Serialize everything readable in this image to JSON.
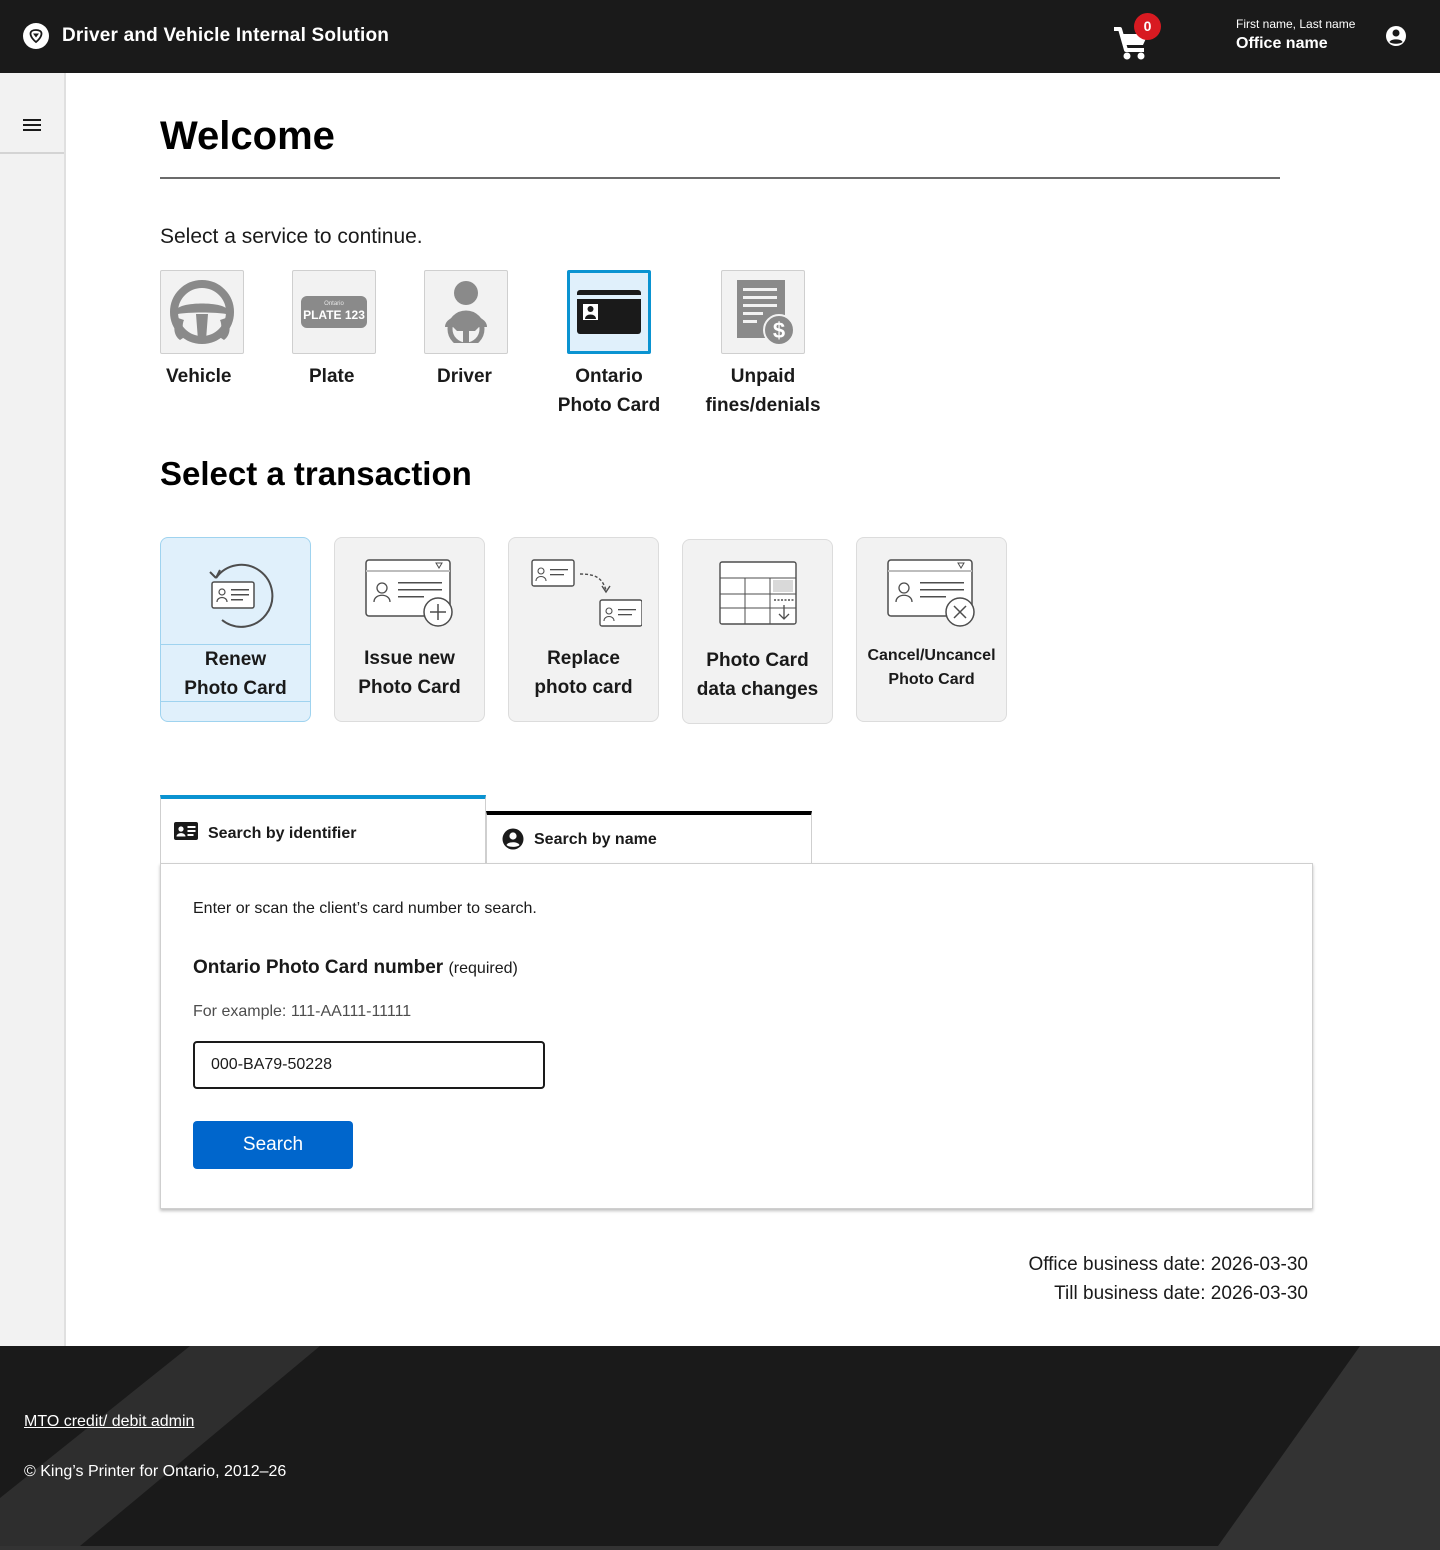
{
  "header": {
    "app_title": "Driver and Vehicle Internal Solution",
    "cart_count": "0",
    "user_name": "First name, Last name",
    "office_name": "Office name"
  },
  "main": {
    "title": "Welcome",
    "service_prompt": "Select a service to continue.",
    "services": [
      {
        "label_1": "Vehicle",
        "label_2": "",
        "icon": "steering-wheel-icon"
      },
      {
        "label_1": "Plate",
        "label_2": "",
        "icon": "licence-plate-icon",
        "plate_small": "Ontario",
        "plate_text": "PLATE 123"
      },
      {
        "label_1": "Driver",
        "label_2": "",
        "icon": "driver-icon"
      },
      {
        "label_1": "Ontario",
        "label_2": "Photo Card",
        "icon": "photo-card-icon",
        "selected": true
      },
      {
        "label_1": "Unpaid",
        "label_2": "fines/denials",
        "icon": "fines-document-icon"
      }
    ],
    "transaction_title": "Select a transaction",
    "transactions": [
      {
        "label_1": "Renew",
        "label_2": "Photo Card",
        "icon": "renew-card-icon",
        "selected": true
      },
      {
        "label_1": "Issue new",
        "label_2": "Photo Card",
        "icon": "issue-card-icon"
      },
      {
        "label_1": "Replace",
        "label_2": "photo card",
        "icon": "replace-card-icon"
      },
      {
        "label_1": "Photo Card",
        "label_2": "data changes",
        "icon": "data-changes-icon"
      },
      {
        "label_1": "Cancel/Uncancel",
        "label_2": "Photo Card",
        "icon": "cancel-card-icon"
      }
    ],
    "tabs": [
      {
        "label": "Search by identifier",
        "icon": "id-card-icon",
        "active": true
      },
      {
        "label": "Search by name",
        "icon": "person-icon",
        "active": false
      }
    ],
    "search_panel": {
      "intro": "Enter or scan the client’s card number to search.",
      "field_label": "Ontario Photo Card number",
      "field_required": "(required)",
      "field_hint": "For example: 111-AA111-11111",
      "field_value": "000-BA79-50228",
      "button_label": "Search"
    },
    "office_business_date": "Office business date: 2026-03-30",
    "till_business_date": "Till business date: 2026-03-30"
  },
  "footer": {
    "link": "MTO credit/ debit admin",
    "copyright": "© King’s Printer for Ontario, 2012–26"
  },
  "colors": {
    "header_bg": "#1a1a1a",
    "accent_blue": "#0a93d1",
    "button_blue": "#0066cc",
    "badge_red": "#d81a21",
    "selected_bg": "#e0f0fb"
  }
}
